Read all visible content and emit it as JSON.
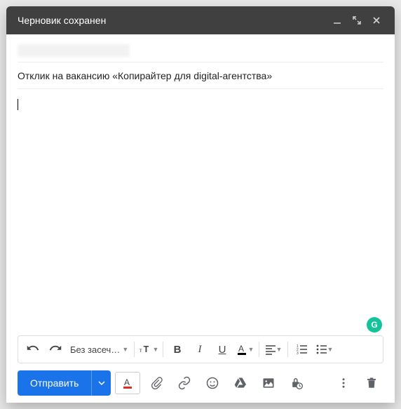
{
  "titlebar": {
    "title": "Черновик сохранен"
  },
  "subject": {
    "value": "Отклик на вакансию «Копирайтер для digital-агентства»"
  },
  "body": {
    "text": ""
  },
  "format_toolbar": {
    "font_label": "Без засеч…"
  },
  "bottom": {
    "send_label": "Отправить"
  },
  "grammarly": {
    "glyph": "G"
  }
}
